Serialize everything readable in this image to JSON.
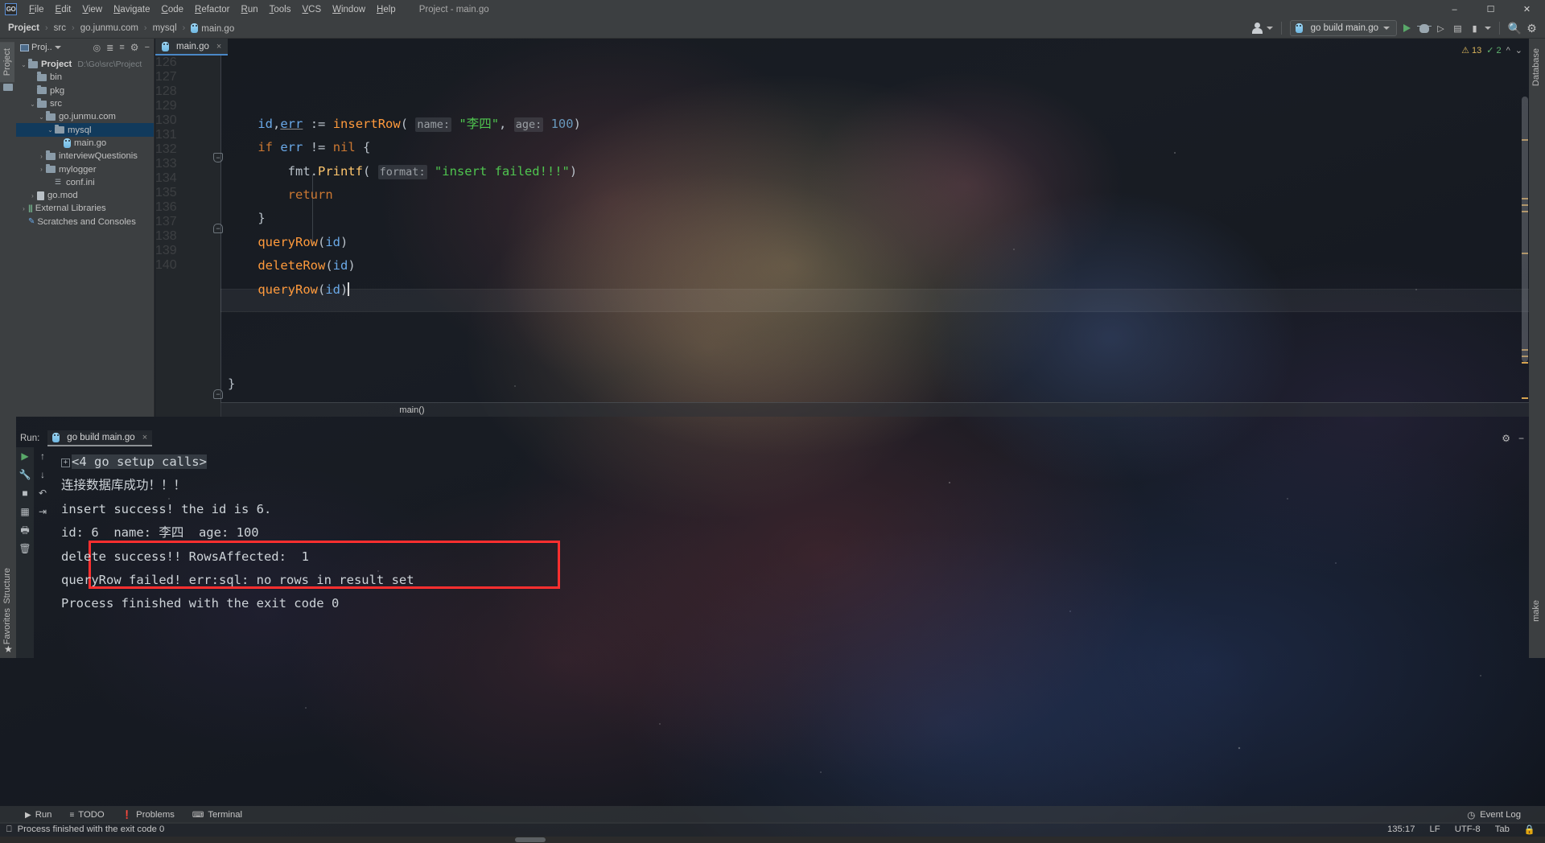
{
  "app": {
    "window_title": "Project - main.go",
    "logo": "goland-logo"
  },
  "menubar": {
    "items": [
      "File",
      "Edit",
      "View",
      "Navigate",
      "Code",
      "Refactor",
      "Run",
      "Tools",
      "VCS",
      "Window",
      "Help"
    ]
  },
  "window_controls": {
    "minimize": "–",
    "maximize": "☐",
    "close": "✕"
  },
  "breadcrumb": {
    "items": [
      "Project",
      "src",
      "go.junmu.com",
      "mysql",
      "main.go"
    ]
  },
  "toolbar": {
    "run_config_label": "go build main.go",
    "run_icon": "run-icon",
    "debug_icon": "debug-icon",
    "coverage_icon": "run-with-coverage-icon",
    "profile_icon": "profile-icon",
    "stop_icon": "stop-icon",
    "search_icon": "search-icon",
    "settings_icon": "settings-icon",
    "user_icon": "user-account-icon"
  },
  "left_tool_strip": {
    "tabs": [
      "Project",
      "Structure",
      "Favorites"
    ]
  },
  "right_tool_strip": {
    "tabs": [
      "Database",
      "make"
    ]
  },
  "project_panel": {
    "title": "Proj..",
    "header_icons": [
      "locate-icon",
      "expand-all-icon",
      "collapse-all-icon",
      "gear-icon",
      "hide-icon"
    ],
    "tree": [
      {
        "label": "Project",
        "sub": "D:\\Go\\src\\Project",
        "indent": 0,
        "arrow": "v",
        "icon": "folder",
        "bold": true,
        "selected": false
      },
      {
        "label": "bin",
        "sub": "",
        "indent": 1,
        "arrow": "",
        "icon": "folder",
        "bold": false,
        "selected": false
      },
      {
        "label": "pkg",
        "sub": "",
        "indent": 1,
        "arrow": "",
        "icon": "folder",
        "bold": false,
        "selected": false
      },
      {
        "label": "src",
        "sub": "",
        "indent": 1,
        "arrow": "v",
        "icon": "folder",
        "bold": false,
        "selected": false
      },
      {
        "label": "go.junmu.com",
        "sub": "",
        "indent": 2,
        "arrow": "v",
        "icon": "folder",
        "bold": false,
        "selected": false
      },
      {
        "label": "mysql",
        "sub": "",
        "indent": 3,
        "arrow": "v",
        "icon": "folder",
        "bold": false,
        "selected": true
      },
      {
        "label": "main.go",
        "sub": "",
        "indent": 4,
        "arrow": "",
        "icon": "gofile",
        "bold": false,
        "selected": false
      },
      {
        "label": "interviewQuestionis",
        "sub": "",
        "indent": 2,
        "arrow": ">",
        "icon": "folder",
        "bold": false,
        "selected": false
      },
      {
        "label": "mylogger",
        "sub": "",
        "indent": 2,
        "arrow": ">",
        "icon": "folder",
        "bold": false,
        "selected": false
      },
      {
        "label": "conf.ini",
        "sub": "",
        "indent": 3,
        "arrow": "",
        "icon": "ini",
        "bold": false,
        "selected": false
      },
      {
        "label": "go.mod",
        "sub": "",
        "indent": 1,
        "arrow": ">",
        "icon": "mod",
        "bold": false,
        "selected": false
      },
      {
        "label": "External Libraries",
        "sub": "",
        "indent": 0,
        "arrow": ">",
        "icon": "lib",
        "bold": false,
        "selected": false
      },
      {
        "label": "Scratches and Consoles",
        "sub": "",
        "indent": 0,
        "arrow": "",
        "icon": "scratch",
        "bold": false,
        "selected": false
      }
    ]
  },
  "editor": {
    "tab_label": "main.go",
    "tab_close": "×",
    "inspection_warnings": "13",
    "inspection_ok": "2",
    "breadcrumb_function": "main()",
    "first_line_number": 126,
    "lines": [
      {
        "n": 126,
        "html": ""
      },
      {
        "n": 127,
        "html": ""
      },
      {
        "n": 128,
        "html": "    <span class=\"id\">id</span><span class=\"pl\">,</span><span class=\"id und\">err</span> <span class=\"pl\">:=</span> <span class=\"fn\">insertRow</span><span class=\"pl\">(</span> <span class=\"hint\">name:</span> <span class=\"str\">\"李四\"</span><span class=\"pl\">,</span> <span class=\"hint\">age:</span> <span class=\"num\">100</span><span class=\"pl\">)</span>"
      },
      {
        "n": 129,
        "html": "    <span class=\"k\">if</span> <span class=\"id\">err</span> <span class=\"pl\">!=</span> <span class=\"k\">nil</span> <span class=\"pl\">{</span>"
      },
      {
        "n": 130,
        "html": "        <span class=\"pl\">fmt.</span><span class=\"mth\">Printf</span><span class=\"pl\">(</span> <span class=\"hint\">format:</span> <span class=\"str\">\"insert failed!!!\"</span><span class=\"pl\">)</span>"
      },
      {
        "n": 131,
        "html": "        <span class=\"k\">return</span>"
      },
      {
        "n": 132,
        "html": "    <span class=\"pl\">}</span>"
      },
      {
        "n": 133,
        "html": "    <span class=\"fn\">queryRow</span><span class=\"pl\">(</span><span class=\"id\">id</span><span class=\"pl\">)</span>"
      },
      {
        "n": 134,
        "html": "    <span class=\"fn\">deleteRow</span><span class=\"pl\">(</span><span class=\"id\">id</span><span class=\"pl\">)</span>"
      },
      {
        "n": 135,
        "html": "    <span class=\"fn\">queryRow</span><span class=\"pl\">(</span><span class=\"id\">id</span><span class=\"pl\">)</span><span class=\"txtcaret\"></span>"
      },
      {
        "n": 136,
        "html": ""
      },
      {
        "n": 137,
        "html": ""
      },
      {
        "n": 138,
        "html": ""
      },
      {
        "n": 139,
        "html": "<span class=\"pl\">}</span>"
      },
      {
        "n": 140,
        "html": ""
      }
    ],
    "plain_lines": [
      "",
      "",
      "    id,err := insertRow( name: \"李四\", age: 100)",
      "    if err != nil {",
      "        fmt.Printf( format: \"insert failed!!!\")",
      "        return",
      "    }",
      "    queryRow(id)",
      "    deleteRow(id)",
      "    queryRow(id)",
      "",
      "",
      "",
      "}",
      ""
    ]
  },
  "run_panel": {
    "label": "Run:",
    "tab_label": "go build main.go",
    "tab_close": "×",
    "settings_icon": "gear-icon",
    "hide_icon": "hide-icon",
    "tool_icons_left": [
      "rerun-icon",
      "wrench-icon",
      "stop-icon",
      "layout-icon",
      "print-icon",
      "trash-icon"
    ],
    "tool_icons_right": [
      "scroll-up-icon",
      "scroll-down-icon",
      "soft-wrap-icon",
      "scroll-to-end-icon"
    ],
    "console_lines": [
      {
        "text": "<4 go setup calls>",
        "highlight": true,
        "fold": true
      },
      {
        "text": "连接数据库成功！！！",
        "highlight": false,
        "fold": false
      },
      {
        "text": "insert success! the id is 6.",
        "highlight": false,
        "fold": false
      },
      {
        "text": "id: 6  name: 李四  age: 100",
        "highlight": false,
        "fold": false
      },
      {
        "text": "delete success!! RowsAffected:  1",
        "highlight": false,
        "fold": false
      },
      {
        "text": "queryRow failed! err:sql: no rows in result set",
        "highlight": false,
        "fold": false
      },
      {
        "text": "Process finished with the exit code 0",
        "highlight": false,
        "fold": false
      }
    ],
    "annotation_box_color": "#ff2f2f"
  },
  "bottom_tabs": [
    {
      "label": "Run",
      "icon": "run-icon"
    },
    {
      "label": "TODO",
      "icon": "todo-icon"
    },
    {
      "label": "Problems",
      "icon": "problems-icon"
    },
    {
      "label": "Terminal",
      "icon": "terminal-icon"
    }
  ],
  "status_bar": {
    "message": "Process finished with the exit code 0",
    "message_icon": "console-icon",
    "event_log": "Event Log",
    "event_log_icon": "event-log-icon",
    "caret_position": "135:17",
    "line_separator": "LF",
    "encoding": "UTF-8",
    "indent": "Tab",
    "lock_icon": "lock-icon"
  },
  "colors": {
    "accent_blue": "#4a88c7",
    "selection_blue": "#113a5c",
    "chrome_gray": "#3c3f41",
    "string_green": "#4fc44f",
    "keyword_orange": "#cc7832",
    "function_orange": "#ff9a3c",
    "number_blue": "#6897bb",
    "warning_yellow": "#d9b45b",
    "ok_green": "#5fb56f",
    "annotation_red": "#ff2f2f"
  }
}
